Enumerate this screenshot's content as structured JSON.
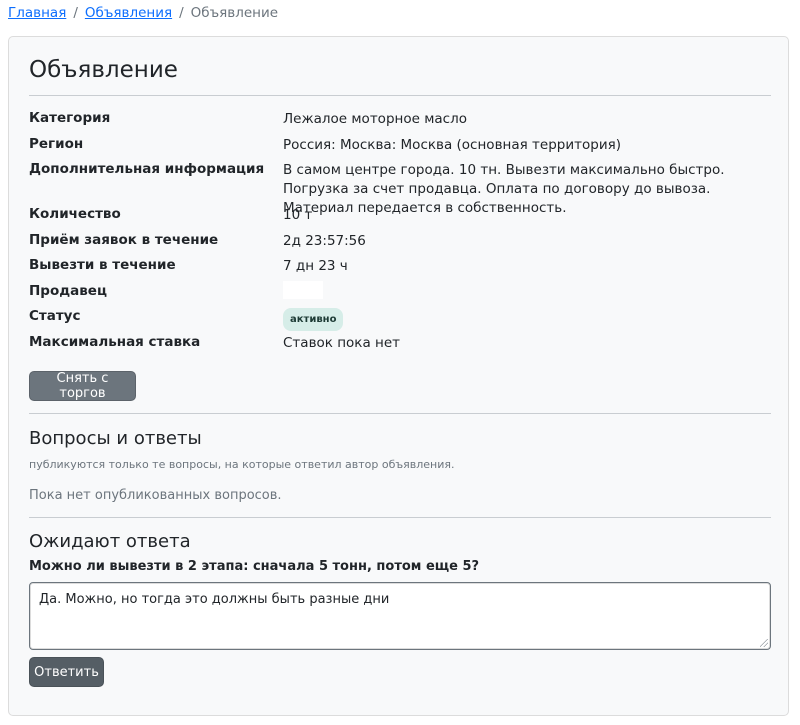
{
  "breadcrumb": {
    "home": "Главная",
    "ads": "Объявления",
    "current": "Объявление",
    "separator": "/"
  },
  "card": {
    "title": "Объявление",
    "details": [
      {
        "label": "Категория",
        "value": "Лежалое моторное масло"
      },
      {
        "label": "Регион",
        "value": "Россия: Москва: Москва (основная территория)"
      },
      {
        "label": "Дополнительная информация",
        "value": "В самом центре города. 10 тн. Вывезти максимально быстро. Погрузка за счет продавца. Оплата по договору до вывоза. Материал передается в собственность."
      },
      {
        "label": "Количество",
        "value": "10 т"
      },
      {
        "label": "Приём заявок в течение",
        "value": "2д 23:57:56"
      },
      {
        "label": "Вывезти в течение",
        "value": "7 дн 23 ч"
      },
      {
        "label": "Продавец",
        "value": ""
      },
      {
        "label": "Статус",
        "value": "активно"
      },
      {
        "label": "Максимальная ставка",
        "value": "Ставок пока нет"
      }
    ],
    "withdraw_button": "Снять с торгов"
  },
  "qa": {
    "title": "Вопросы и ответы",
    "note": "публикуются только те вопросы, на которые ответил автор объявления.",
    "empty": "Пока нет опубликованных вопросов."
  },
  "pending": {
    "title": "Ожидают ответа",
    "question": "Можно ли вывезти в 2 этапа: сначала 5 тонн, потом еще 5?",
    "answer_value": "Да. Можно, но тогда это должны быть разные дни",
    "reply_button": "Ответить"
  },
  "colors": {
    "link": "#0d6efd",
    "button": "#6c757d",
    "badge_bg": "#d6ede8",
    "card_bg": "#f8f9fa"
  }
}
